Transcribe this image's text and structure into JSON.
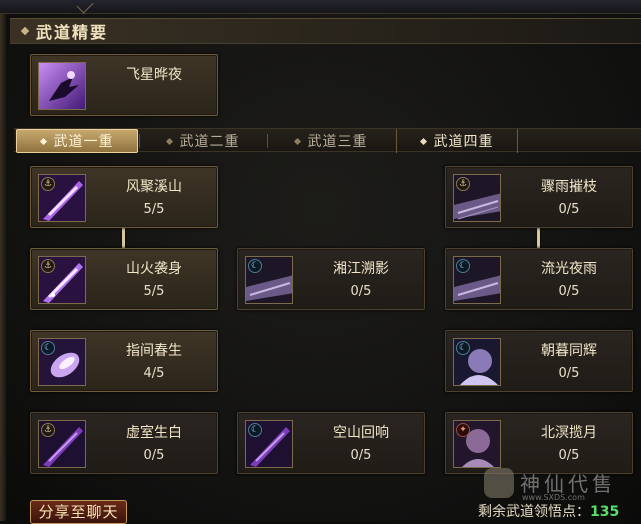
{
  "section": {
    "title": "武道精要"
  },
  "essence": {
    "name": "飞星晔夜"
  },
  "tabs": [
    {
      "label": "武道一重"
    },
    {
      "label": "武道二重"
    },
    {
      "label": "武道三重"
    },
    {
      "label": "武道四重"
    }
  ],
  "skills": [
    {
      "name": "风聚溪山",
      "level": "5/5"
    },
    {
      "name": "骤雨摧枝",
      "level": "0/5"
    },
    {
      "name": "山火袭身",
      "level": "5/5"
    },
    {
      "name": "湘江溯影",
      "level": "0/5"
    },
    {
      "name": "流光夜雨",
      "level": "0/5"
    },
    {
      "name": "指间春生",
      "level": "4/5"
    },
    {
      "name": "朝暮同辉",
      "level": "0/5"
    },
    {
      "name": "虚室生白",
      "level": "0/5"
    },
    {
      "name": "空山回响",
      "level": "0/5"
    },
    {
      "name": "北溟揽月",
      "level": "0/5"
    }
  ],
  "footer": {
    "share_label": "分享至聊天",
    "points_label": "剩余武道领悟点：",
    "points_value": "135"
  },
  "watermark": {
    "text": "神仙代售",
    "url": "www.SXDS.com"
  },
  "colors": {
    "accent_gold": "#c9ab70",
    "points_green": "#56e06a",
    "share_button_red": "#6a2a18"
  }
}
